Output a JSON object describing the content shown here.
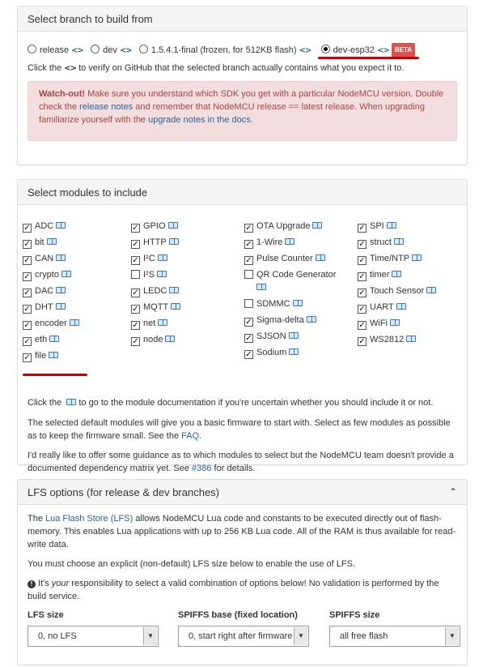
{
  "branch_panel": {
    "title": "Select branch to build from",
    "options": [
      {
        "label": "release",
        "selected": false,
        "code_icon": "<>"
      },
      {
        "label": "dev",
        "selected": false,
        "code_icon": "<>"
      },
      {
        "label": "1.5.4.1-final (frozen, for 512KB flash)",
        "selected": false,
        "code_icon": "<>"
      },
      {
        "label": "dev-esp32",
        "selected": true,
        "code_icon": "<>",
        "badge": "BETA"
      }
    ],
    "hint_before": "Click the",
    "hint_after": "to verify on GitHub that the selected branch actually contains what you expect it to.",
    "alert": {
      "strong": "Watch-out!",
      "t1": " Make sure you understand which SDK you get with a particular NodeMCU version. Double check the ",
      "link1": "release notes",
      "t2": " and remember that NodeMCU release == latest release. When upgrading familiarize yourself with the ",
      "link2": "upgrade notes in the docs",
      "t3": "."
    }
  },
  "modules_panel": {
    "title": "Select modules to include",
    "columns": [
      [
        {
          "label": "ADC",
          "checked": true
        },
        {
          "label": "bit",
          "checked": true
        },
        {
          "label": "CAN",
          "checked": true
        },
        {
          "label": "crypto",
          "checked": true
        },
        {
          "label": "DAC",
          "checked": true
        },
        {
          "label": "DHT",
          "checked": true
        },
        {
          "label": "encoder",
          "checked": true
        },
        {
          "label": "eth",
          "checked": true
        },
        {
          "label": "file",
          "checked": true
        }
      ],
      [
        {
          "label": "GPIO",
          "checked": true
        },
        {
          "label": "HTTP",
          "checked": true
        },
        {
          "label": "I²C",
          "checked": true
        },
        {
          "label": "I²S",
          "checked": false
        },
        {
          "label": "LEDC",
          "checked": true
        },
        {
          "label": "MQTT",
          "checked": true
        },
        {
          "label": "net",
          "checked": true
        },
        {
          "label": "node",
          "checked": true
        }
      ],
      [
        {
          "label": "OTA Upgrade",
          "checked": true
        },
        {
          "label": "1-Wire",
          "checked": true
        },
        {
          "label": "Pulse Counter",
          "checked": true
        },
        {
          "label": "QR Code Generator",
          "checked": false
        },
        {
          "label": "SDMMC",
          "checked": false
        },
        {
          "label": "Sigma-delta",
          "checked": true
        },
        {
          "label": "SJSON",
          "checked": true
        },
        {
          "label": "Sodium",
          "checked": true
        }
      ],
      [
        {
          "label": "SPI",
          "checked": true
        },
        {
          "label": "struct",
          "checked": true
        },
        {
          "label": "Time/NTP",
          "checked": true
        },
        {
          "label": "timer",
          "checked": true
        },
        {
          "label": "Touch Sensor",
          "checked": true
        },
        {
          "label": "UART",
          "checked": true
        },
        {
          "label": "WiFi",
          "checked": true
        },
        {
          "label": "WS2812",
          "checked": true
        }
      ]
    ],
    "doc_hint_before": "Click the",
    "doc_hint_after": "to go to the module documentation if you're uncertain whether you should include it or not.",
    "p1": "The selected default modules will give you a basic firmware to start with. Select as few modules as possible as to keep the firmware small. See the ",
    "p1_link": "FAQ",
    "p1_end": ".",
    "p2": "I'd really like to offer some guidance as to which modules to select but the NodeMCU team doesn't provide a documented dependency matrix yet. See ",
    "p2_link": "#386",
    "p2_end": " for details."
  },
  "lfs_panel": {
    "title": "LFS options (for release & dev branches)",
    "p1_a": "The ",
    "p1_link": "Lua Flash Store (LFS)",
    "p1_b": " allows NodeMCU Lua code and constants to be executed directly out of flash-memory. This enables Lua applications with up to 256 KB Lua code. All of the RAM is thus available for read-write data.",
    "p2": "You must choose an explicit (non-default) LFS size below to enable the use of LFS.",
    "p3_a": "It's ",
    "p3_em": "your",
    "p3_b": " responsibility to select a valid combination of options below! No validation is performed by the build service.",
    "fields": [
      {
        "label": "LFS size",
        "value": "0, no LFS"
      },
      {
        "label": "SPIFFS base (fixed location)",
        "value": "0, start right after firmware"
      },
      {
        "label": "SPIFFS size",
        "value": "all free flash"
      }
    ]
  },
  "colors": {
    "accent_link": "#2a6496",
    "alert_bg": "#f2dede",
    "alert_text": "#a94442",
    "badge": "#d9534f",
    "annotation": "#cc0000"
  }
}
